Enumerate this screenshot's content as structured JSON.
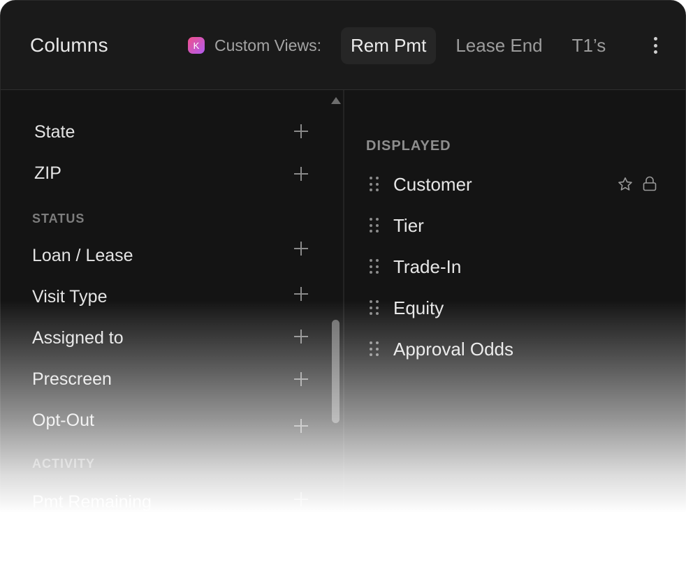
{
  "header": {
    "title": "Columns",
    "avatar_letter": "K",
    "custom_views_label": "Custom Views:",
    "views": [
      {
        "label": "Rem Pmt",
        "active": true
      },
      {
        "label": "Lease End",
        "active": false
      },
      {
        "label": "T1’s",
        "active": false
      }
    ],
    "more_icon": "vertical-ellipsis-icon"
  },
  "available": {
    "items_top": [
      {
        "label": "State"
      },
      {
        "label": "ZIP"
      }
    ],
    "sections": [
      {
        "heading": "STATUS",
        "items": [
          {
            "label": "Loan / Lease"
          },
          {
            "label": "Visit Type"
          },
          {
            "label": "Assigned to"
          },
          {
            "label": "Prescreen"
          },
          {
            "label": "Opt-Out"
          }
        ]
      },
      {
        "heading": "ACTIVITY",
        "items": [
          {
            "label": "Pmt Remaining"
          }
        ]
      }
    ],
    "add_icon": "plus-icon"
  },
  "displayed": {
    "heading": "DISPLAYED",
    "items": [
      {
        "label": "Customer",
        "pinned": true,
        "locked": true
      },
      {
        "label": "Tier"
      },
      {
        "label": "Trade-In"
      },
      {
        "label": "Equity"
      },
      {
        "label": "Approval Odds"
      }
    ],
    "drag_icon": "drag-handle-icon",
    "pin_icon": "star-icon",
    "lock_icon": "lock-icon"
  },
  "colors": {
    "panel_bg": "#141414",
    "header_bg": "#1a1a1a",
    "active_tab_bg": "#262626",
    "avatar_gradient_start": "#f0508a",
    "avatar_gradient_end": "#b05cf0"
  }
}
